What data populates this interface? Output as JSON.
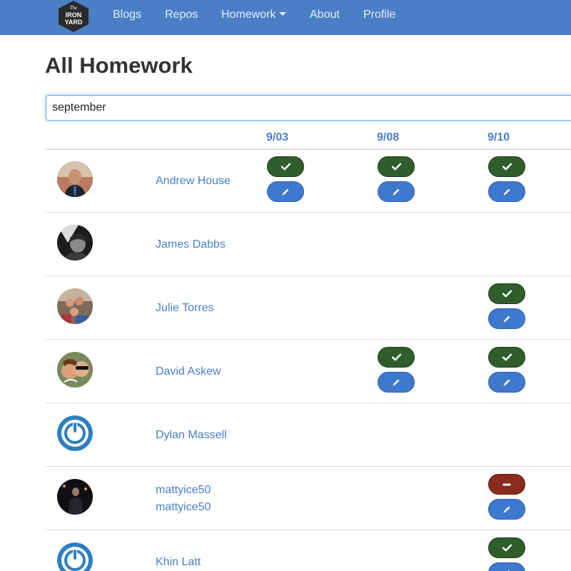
{
  "nav": {
    "logo_text_line1": "The",
    "logo_text_line2": "IRON",
    "logo_text_line3": "YARD",
    "items": [
      {
        "label": "Blogs"
      },
      {
        "label": "Repos"
      },
      {
        "label": "Homework"
      },
      {
        "label": "About"
      },
      {
        "label": "Profile"
      }
    ]
  },
  "page": {
    "title": "All Homework"
  },
  "search": {
    "value": "september"
  },
  "table": {
    "columns": [
      "9/03",
      "9/08",
      "9/10"
    ],
    "rows": [
      {
        "name": "Andrew House",
        "avatar": "photo",
        "cells": [
          "complete",
          "complete",
          "complete"
        ]
      },
      {
        "name": "James Dabbs",
        "avatar": "photo",
        "cells": [
          "",
          "",
          ""
        ]
      },
      {
        "name": "Julie Torres",
        "avatar": "photo",
        "cells": [
          "",
          "",
          "complete"
        ]
      },
      {
        "name": "David Askew",
        "avatar": "photo",
        "cells": [
          "",
          "complete",
          "complete"
        ]
      },
      {
        "name": "Dylan Massell",
        "avatar": "default-power-icon",
        "cells": [
          "",
          "",
          ""
        ]
      },
      {
        "name": "mattyice50",
        "name2": "mattyice50",
        "avatar": "photo",
        "cells": [
          "",
          "",
          "incomplete"
        ]
      },
      {
        "name": "Khin Latt",
        "avatar": "default-power-icon",
        "cells": [
          "",
          "",
          "complete"
        ]
      }
    ]
  },
  "colors": {
    "navbar": "#4a7fc6",
    "link": "#4a7fc6",
    "complete_button": "#2f5e2c",
    "edit_button": "#3f78cf",
    "incomplete_button": "#8a2b1e"
  },
  "icons": {
    "complete": "check-icon",
    "edit": "pencil-icon",
    "incomplete": "minus-icon"
  }
}
